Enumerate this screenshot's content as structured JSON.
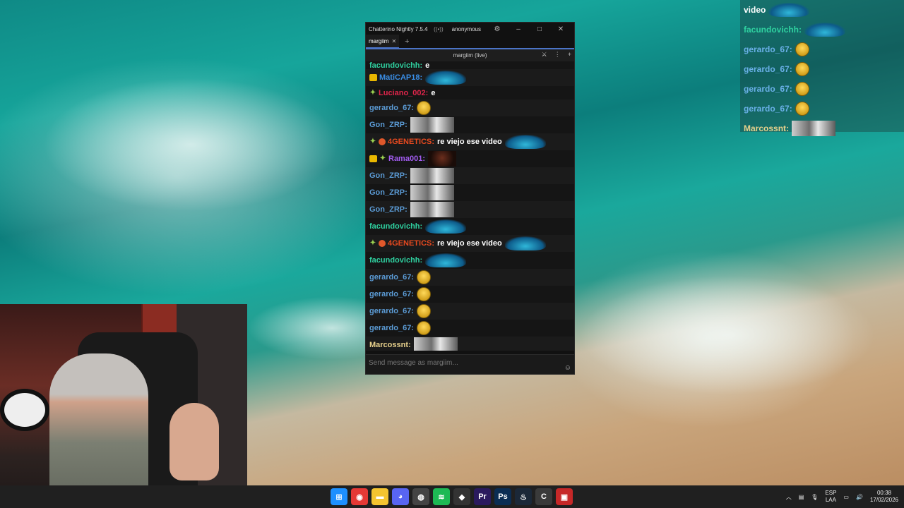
{
  "chatterino": {
    "window_title": "Chatterino Nightly 7.5.4",
    "account": "anonymous",
    "tab_label": "margiim",
    "split_title": "margiim (live)",
    "input_placeholder": "Send message as margiim...",
    "messages": [
      {
        "user": "facundovichh:",
        "color": "#2fd1a0",
        "text": "e",
        "badges": [],
        "emote": ""
      },
      {
        "user": "MatiCAP18:",
        "color": "#3a8ee6",
        "text": "",
        "badges": [
          "sub"
        ],
        "emote": "blob"
      },
      {
        "user": "Luciano_002:",
        "color": "#e0254b",
        "text": "e",
        "badges": [
          "vip"
        ],
        "emote": ""
      },
      {
        "user": "gerardo_67:",
        "color": "#5b9bd5",
        "text": "",
        "badges": [],
        "emote": "lol"
      },
      {
        "user": "Gon_ZRP:",
        "color": "#5b9bd5",
        "text": "",
        "badges": [],
        "emote": "photo"
      },
      {
        "user": "4GENETICS:",
        "color": "#e6491f",
        "text": "re viejo ese video",
        "badges": [
          "vip",
          "emblem"
        ],
        "emote": "blob"
      },
      {
        "user": "Rama001:",
        "color": "#a25cf0",
        "text": "",
        "badges": [
          "sub",
          "vip"
        ],
        "emote": "face"
      },
      {
        "user": "Gon_ZRP:",
        "color": "#5b9bd5",
        "text": "",
        "badges": [],
        "emote": "photo"
      },
      {
        "user": "Gon_ZRP:",
        "color": "#5b9bd5",
        "text": "",
        "badges": [],
        "emote": "photo"
      },
      {
        "user": "Gon_ZRP:",
        "color": "#5b9bd5",
        "text": "",
        "badges": [],
        "emote": "photo"
      },
      {
        "user": "facundovichh:",
        "color": "#2fd1a0",
        "text": "",
        "badges": [],
        "emote": "blob"
      },
      {
        "user": "4GENETICS:",
        "color": "#e6491f",
        "text": "re viejo ese video",
        "badges": [
          "vip",
          "emblem"
        ],
        "emote": "blob"
      },
      {
        "user": "facundovichh:",
        "color": "#2fd1a0",
        "text": "",
        "badges": [],
        "emote": "blob"
      },
      {
        "user": "gerardo_67:",
        "color": "#5b9bd5",
        "text": "",
        "badges": [],
        "emote": "lol"
      },
      {
        "user": "gerardo_67:",
        "color": "#5b9bd5",
        "text": "",
        "badges": [],
        "emote": "lol"
      },
      {
        "user": "gerardo_67:",
        "color": "#5b9bd5",
        "text": "",
        "badges": [],
        "emote": "lol"
      },
      {
        "user": "gerardo_67:",
        "color": "#5b9bd5",
        "text": "",
        "badges": [],
        "emote": "lol"
      },
      {
        "user": "Marcossnt:",
        "color": "#e8d18c",
        "text": "",
        "badges": [],
        "emote": "photo"
      }
    ]
  },
  "overlay": {
    "rows": [
      {
        "user": "",
        "color": "#ffffff",
        "text": "video",
        "emote": "blob"
      },
      {
        "user": "facundovichh:",
        "color": "#2fd1a0",
        "text": "",
        "emote": "blob"
      },
      {
        "user": "gerardo_67:",
        "color": "#6ab0e8",
        "text": "",
        "emote": "lol"
      },
      {
        "user": "gerardo_67:",
        "color": "#6ab0e8",
        "text": "",
        "emote": "lol"
      },
      {
        "user": "gerardo_67:",
        "color": "#6ab0e8",
        "text": "",
        "emote": "lol"
      },
      {
        "user": "gerardo_67:",
        "color": "#6ab0e8",
        "text": "",
        "emote": "lol"
      },
      {
        "user": "Marcossnt:",
        "color": "#e8d18c",
        "text": "",
        "emote": "photo"
      }
    ]
  },
  "taskbar": {
    "apps": [
      {
        "name": "windows-start-icon",
        "glyph": "⊞",
        "color": "#1e90ff"
      },
      {
        "name": "chrome-icon",
        "glyph": "◉",
        "color": "#e53935"
      },
      {
        "name": "file-explorer-icon",
        "glyph": "▬",
        "color": "#f4c430"
      },
      {
        "name": "discord-icon",
        "glyph": "◕",
        "color": "#5865f2"
      },
      {
        "name": "obs-icon",
        "glyph": "◍",
        "color": "#444444"
      },
      {
        "name": "spotify-icon",
        "glyph": "≋",
        "color": "#1db954"
      },
      {
        "name": "epic-icon",
        "glyph": "◆",
        "color": "#333333"
      },
      {
        "name": "premiere-icon",
        "glyph": "Pr",
        "color": "#2a1a5e"
      },
      {
        "name": "photoshop-icon",
        "glyph": "Ps",
        "color": "#0b2d53"
      },
      {
        "name": "steam-icon",
        "glyph": "♨",
        "color": "#1b2838"
      },
      {
        "name": "chatterino-icon",
        "glyph": "C",
        "color": "#3a3a3a"
      },
      {
        "name": "voicemeeter-icon",
        "glyph": "▣",
        "color": "#c62828"
      }
    ],
    "lang_line1": "ESP",
    "lang_line2": "LAA",
    "time": "00:38",
    "date": "17/02/2026"
  }
}
